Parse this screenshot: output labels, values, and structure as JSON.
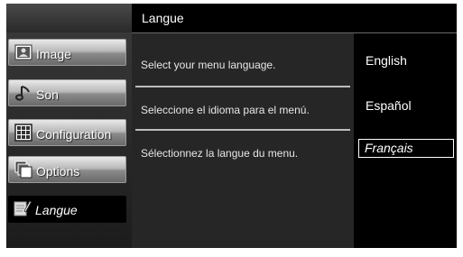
{
  "header": {
    "title": "Langue"
  },
  "menu": {
    "items": [
      {
        "label": "Image",
        "icon": "image-icon",
        "selected": false
      },
      {
        "label": "Son",
        "icon": "music-note-icon",
        "selected": false
      },
      {
        "label": "Configuration",
        "icon": "grid-icon",
        "selected": false
      },
      {
        "label": "Options",
        "icon": "stacked-windows-icon",
        "selected": false
      },
      {
        "label": "Langue",
        "icon": "document-pen-icon",
        "selected": true
      }
    ]
  },
  "descriptions": [
    "Select your menu language.",
    "Seleccione el idioma para el menú.",
    "Sélectionnez la langue du menu."
  ],
  "languages": {
    "options": [
      "English",
      "Español",
      "Français"
    ],
    "selected": "Français"
  },
  "colors": {
    "panel_background": "#000000",
    "description_background": "#262626",
    "button_gradient_top": "#e9e9e9",
    "button_gradient_bottom": "#6a6a6a",
    "text": "#ffffff"
  }
}
